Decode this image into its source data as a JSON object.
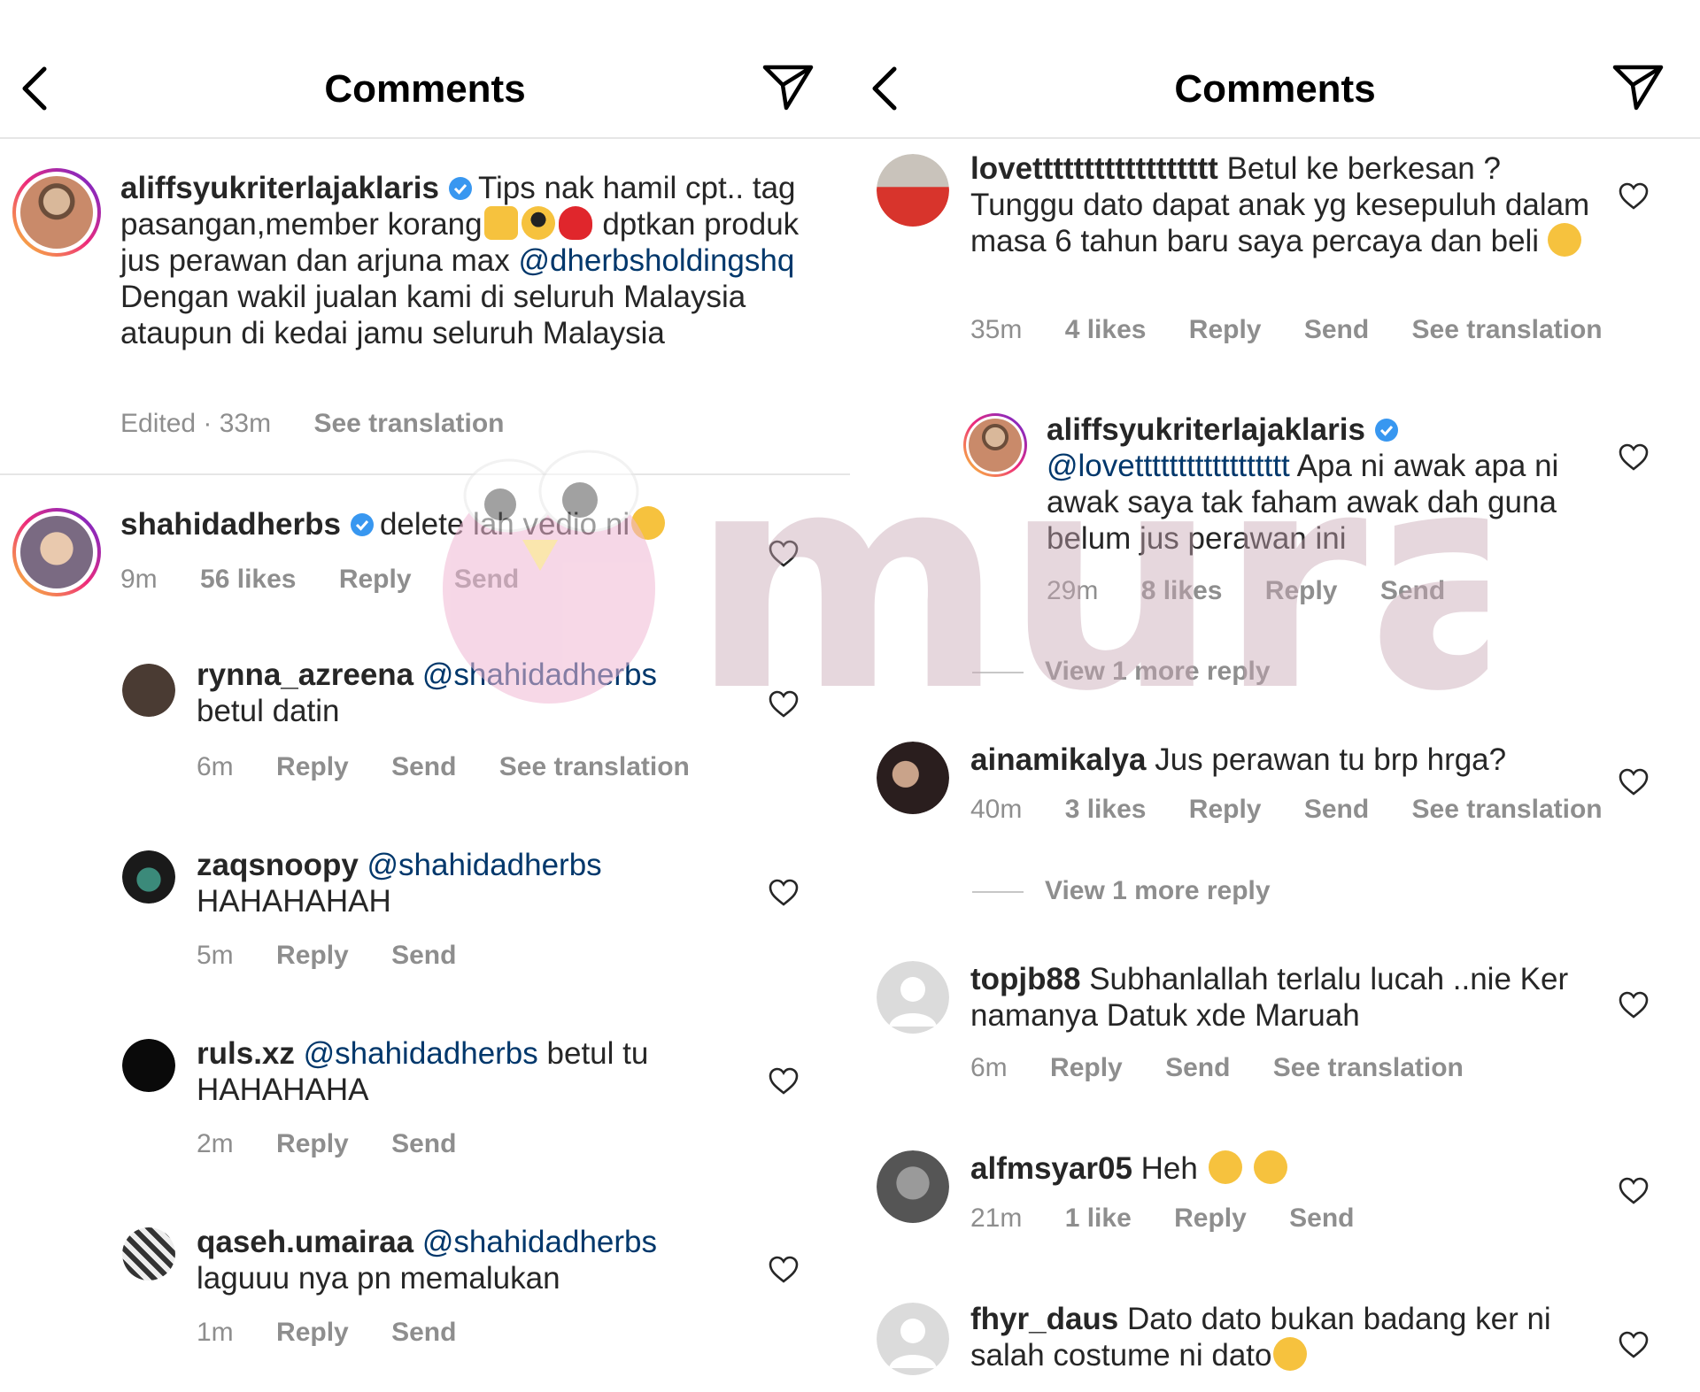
{
  "left_panel": {
    "header": {
      "title": "Comments",
      "back_icon": "chevron-left-icon",
      "share_icon": "paper-plane-icon"
    },
    "caption": {
      "username": "aliffsyukriterlajaklaris",
      "text_part1": "Tips nak hamil cpt.. tag pasangan,member korang",
      "text_part2": "dptkan produk jus perawan dan arjuna max",
      "mention": "@dherbsholdingshq",
      "text_part3": "Dengan wakil jualan kami di seluruh Malaysia ataupun di kedai jamu seluruh Malaysia",
      "edited": "Edited · 33m",
      "see_translation": "See translation"
    },
    "comments": [
      {
        "username": "shahidadherbs",
        "text": "delete lah vedio ni",
        "time": "9m",
        "likes": "56 likes",
        "reply": "Reply",
        "send": "Send"
      },
      {
        "username": "rynna_azreena",
        "mention": "@shahidadherbs",
        "text": "betul datin",
        "time": "6m",
        "reply": "Reply",
        "send": "Send",
        "see_translation": "See translation"
      },
      {
        "username": "zaqsnoopy",
        "mention": "@shahidadherbs",
        "text": "HAHAHAHAH",
        "time": "5m",
        "reply": "Reply",
        "send": "Send"
      },
      {
        "username": "ruls.xz",
        "mention": "@shahidadherbs",
        "text": "betul tu HAHAHAHA",
        "time": "2m",
        "reply": "Reply",
        "send": "Send"
      },
      {
        "username": "qaseh.umairaa",
        "mention": "@shahidadherbs",
        "text": "laguuu nya pn memalukan",
        "time": "1m",
        "reply": "Reply",
        "send": "Send"
      }
    ]
  },
  "right_panel": {
    "header": {
      "title": "Comments",
      "back_icon": "chevron-left-icon",
      "share_icon": "paper-plane-icon"
    },
    "comments": [
      {
        "username": "lovetttttttttttttttttt",
        "text": "Betul ke berkesan ? Tunggu dato dapat anak yg kesepuluh dalam masa 6 tahun baru saya percaya dan beli",
        "time": "35m",
        "likes": "4 likes",
        "reply": "Reply",
        "send": "Send",
        "see_translation": "See translation"
      },
      {
        "username": "aliffsyukriterlajaklaris",
        "mention": "@lovetttttttttttttttttt",
        "text": "Apa ni awak apa ni awak saya tak faham awak dah guna belum jus perawan ini",
        "time": "29m",
        "likes": "8 likes",
        "reply": "Reply",
        "send": "Send"
      },
      {
        "username": "ainamikalya",
        "text": "Jus perawan tu brp hrga?",
        "time": "40m",
        "likes": "3 likes",
        "reply": "Reply",
        "send": "Send",
        "see_translation": "See translation"
      },
      {
        "username": "topjb88",
        "text": "Subhanlallah terlalu lucah ..nie Ker namanya Datuk xde Maruah",
        "time": "6m",
        "reply": "Reply",
        "send": "Send",
        "see_translation": "See translation"
      },
      {
        "username": "alfmsyar05",
        "text": "Heh",
        "time": "21m",
        "likes": "1 like",
        "reply": "Reply",
        "send": "Send"
      },
      {
        "username": "fhyr_daus",
        "text": "Dato dato bukan badang ker ni salah costume ni dato"
      }
    ],
    "view_more_1": "View 1 more reply",
    "view_more_2": "View 1 more reply"
  },
  "watermark": {
    "text": "murai",
    "color": "#c8a8b4"
  },
  "colors": {
    "mention": "#00376b",
    "meta": "#8e8e8e",
    "verified": "#3897f0"
  }
}
